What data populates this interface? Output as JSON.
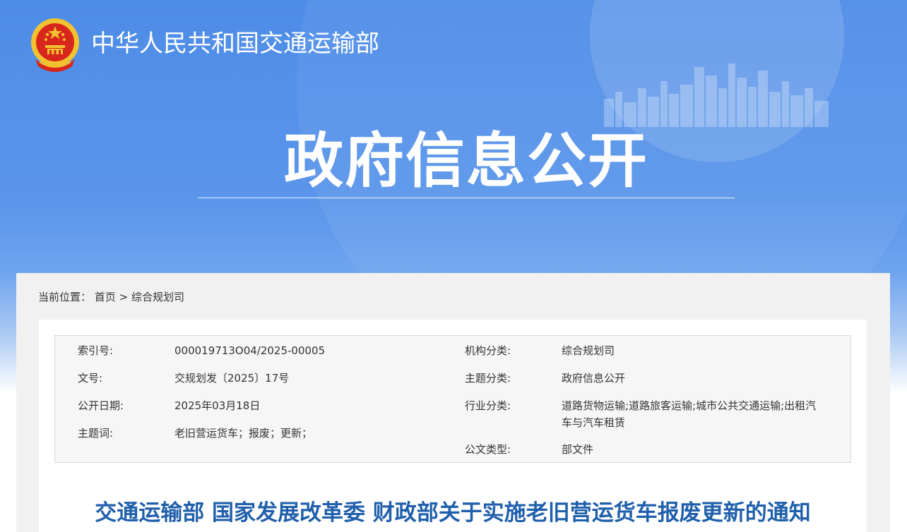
{
  "header": {
    "ministry_name": "中华人民共和国交通运输部",
    "hero_title": "政府信息公开"
  },
  "breadcrumb": {
    "prefix": "当前位置：",
    "home": "首页",
    "separator": ">",
    "current": "综合规划司"
  },
  "meta": {
    "left": [
      {
        "label": "索引号:",
        "value": "000019713O04/2025-00005"
      },
      {
        "label": "文号:",
        "value": "交规划发〔2025〕17号"
      },
      {
        "label": "公开日期:",
        "value": "2025年03月18日"
      },
      {
        "label": "主题词:",
        "value": "老旧营运货车；报废；更新；"
      }
    ],
    "right": [
      {
        "label": "机构分类:",
        "value": "综合规划司"
      },
      {
        "label": "主题分类:",
        "value": "政府信息公开"
      },
      {
        "label": "行业分类:",
        "value": "道路货物运输;道路旅客运输;城市公共交通运输;出租汽车与汽车租赁"
      },
      {
        "label": "公文类型:",
        "value": "部文件"
      }
    ]
  },
  "document": {
    "title": "交通运输部 国家发展改革委 财政部关于实施老旧营运货车报废更新的通知"
  },
  "colors": {
    "banner_blue": "#4d8ce8",
    "title_blue": "#1f5fab",
    "emblem_red": "#d8261c",
    "emblem_gold": "#f2c230"
  },
  "icons": {
    "emblem": "national-emblem-icon"
  }
}
